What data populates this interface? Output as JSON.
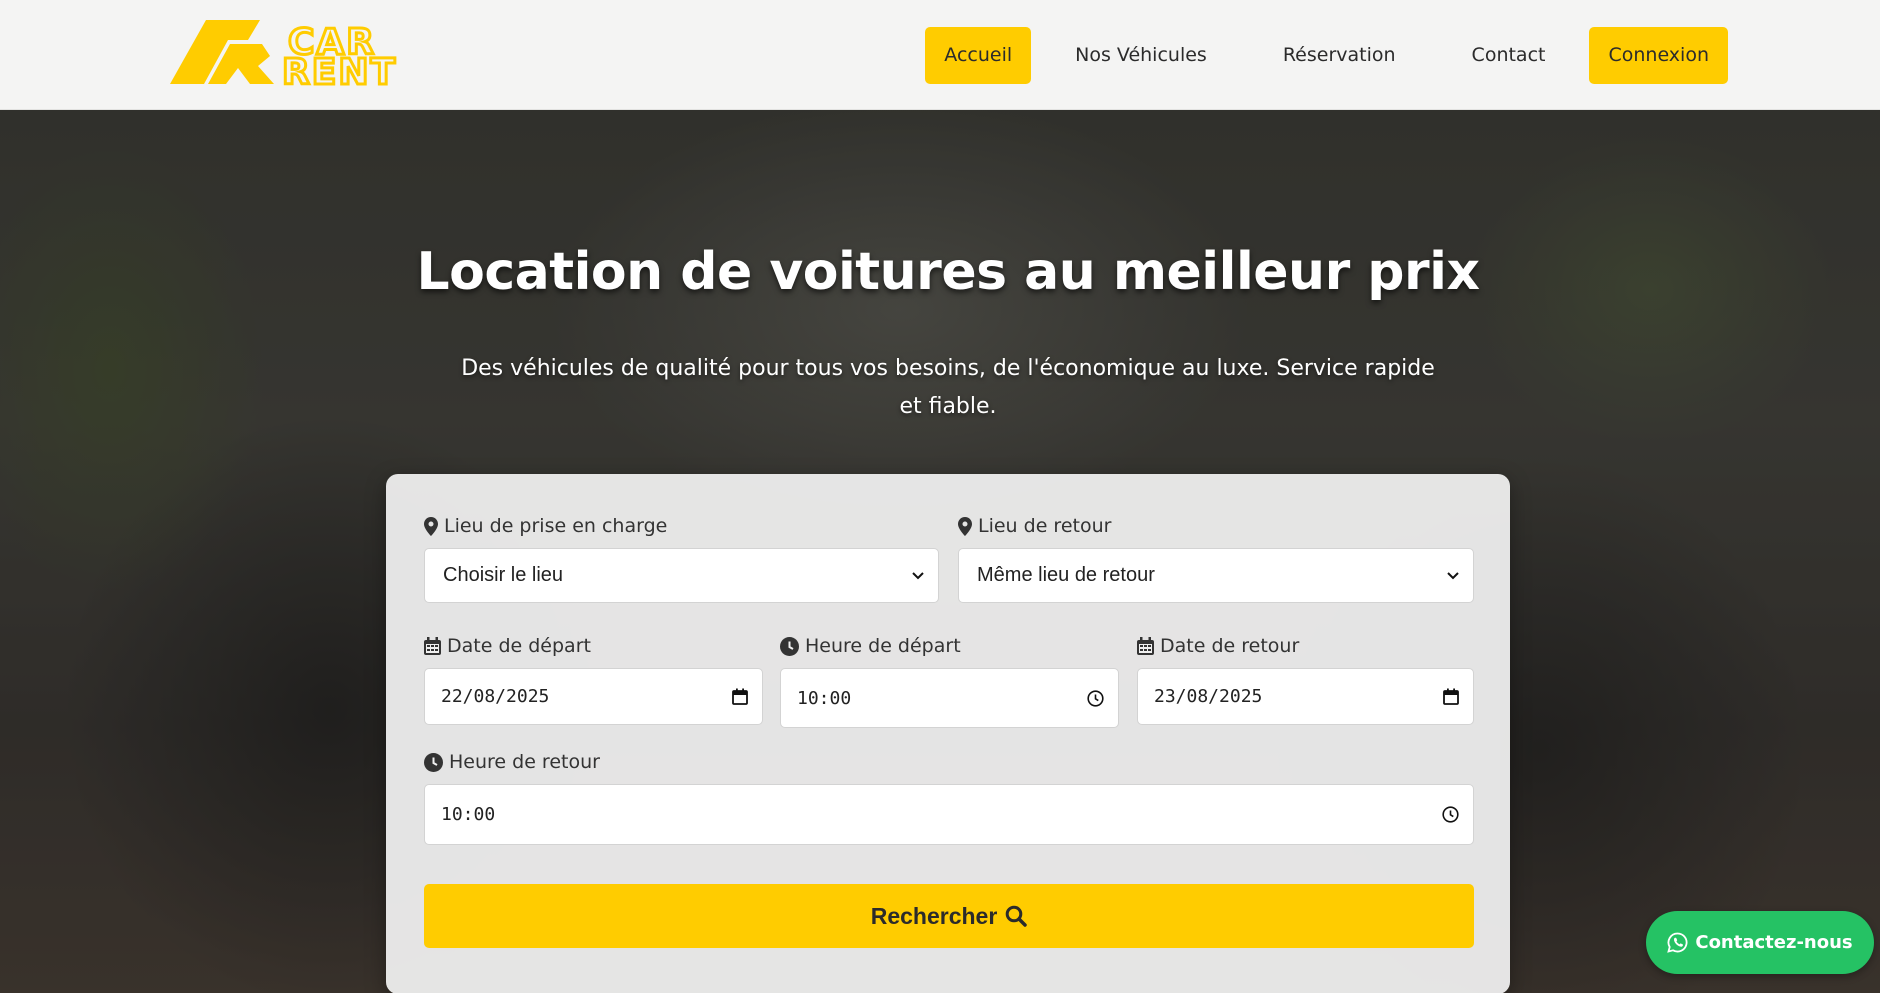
{
  "brand": {
    "logo_line1": "CAR",
    "logo_line2": "RENT",
    "color": "#ffcc00"
  },
  "nav": {
    "items": [
      {
        "label": "Accueil",
        "active": true
      },
      {
        "label": "Nos Véhicules",
        "active": false
      },
      {
        "label": "Réservation",
        "active": false
      },
      {
        "label": "Contact",
        "active": false
      }
    ],
    "login_label": "Connexion"
  },
  "hero": {
    "title": "Location de voitures au meilleur prix",
    "subtitle": "Des véhicules de qualité pour tous vos besoins, de l'économique au luxe. Service rapide et fiable."
  },
  "form": {
    "pickup_location": {
      "label": "Lieu de prise en charge",
      "value": "Choisir le lieu",
      "icon": "map-marker-icon"
    },
    "return_location": {
      "label": "Lieu de retour",
      "value": "Même lieu de retour",
      "icon": "map-marker-icon"
    },
    "departure_date": {
      "label": "Date de départ",
      "value": "22/08/2025",
      "icon": "calendar-icon"
    },
    "departure_time": {
      "label": "Heure de départ",
      "value": "10:00",
      "icon": "clock-icon"
    },
    "return_date": {
      "label": "Date de retour",
      "value": "23/08/2025",
      "icon": "calendar-icon"
    },
    "return_time": {
      "label": "Heure de retour",
      "value": "10:00",
      "icon": "clock-icon"
    },
    "search_label": "Rechercher",
    "search_icon": "search-icon"
  },
  "whatsapp": {
    "label": "Contactez-nous",
    "icon": "whatsapp-icon",
    "color": "#25c264"
  },
  "colors": {
    "accent": "#ffcc00",
    "navbar_bg": "#f4f4f3",
    "card_bg": "#f0f0f0"
  }
}
